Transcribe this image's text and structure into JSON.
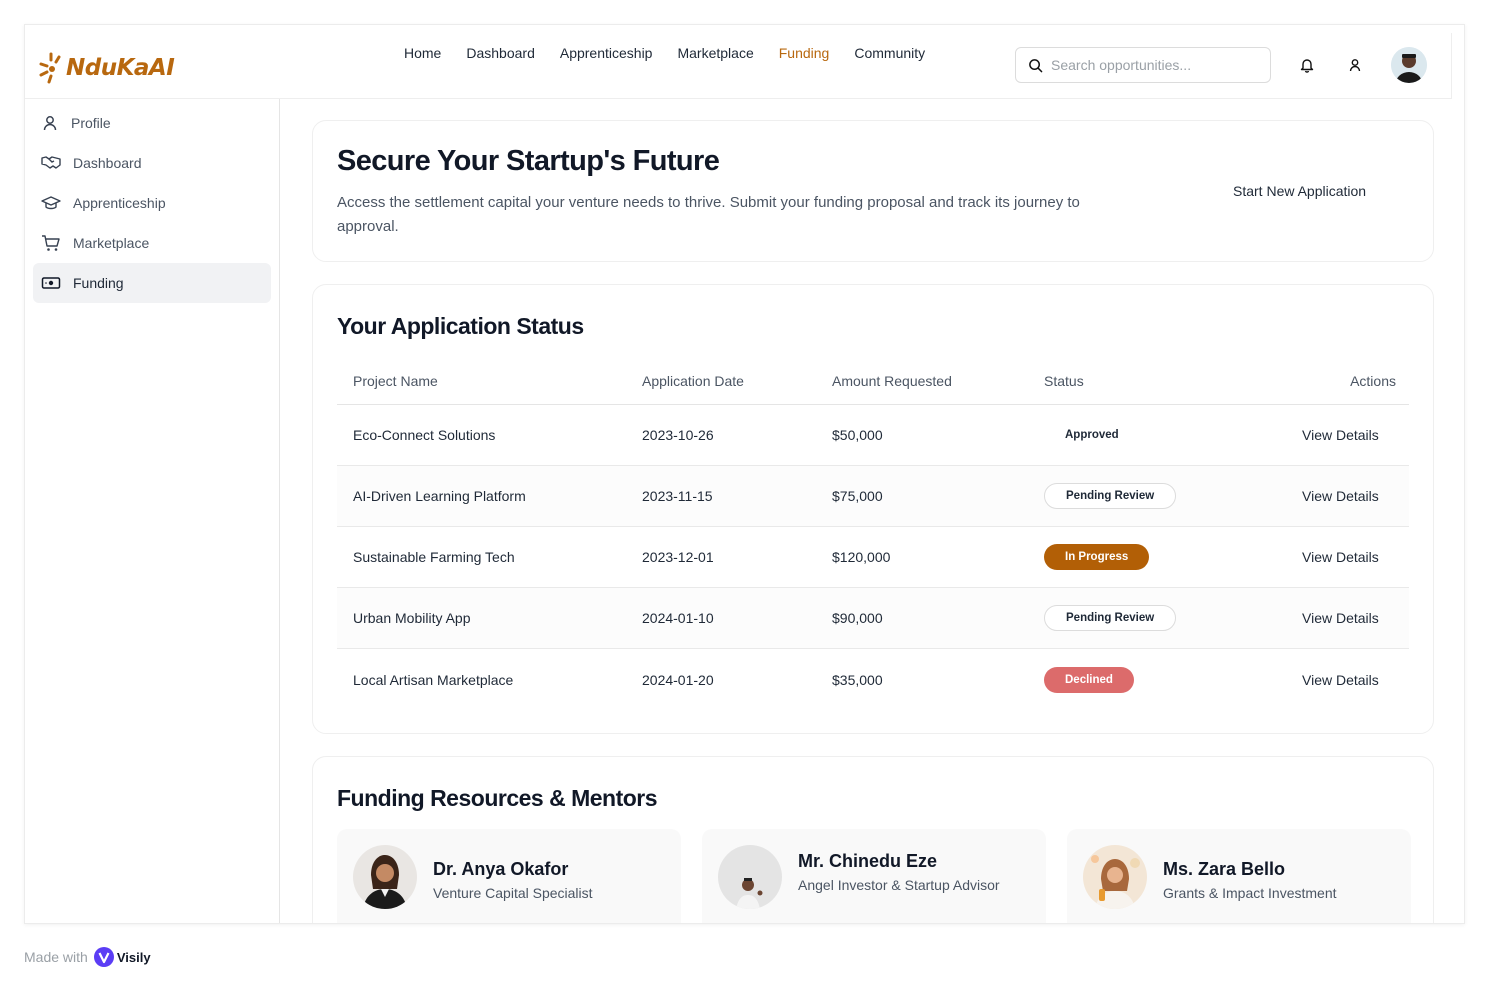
{
  "brand": {
    "name": "NduKaAI",
    "color": "#b8680f"
  },
  "nav": {
    "items": [
      "Home",
      "Dashboard",
      "Apprenticeship",
      "Marketplace",
      "Funding",
      "Community"
    ],
    "active": "Funding"
  },
  "search": {
    "placeholder": "Search opportunities..."
  },
  "sidebar": {
    "items": [
      {
        "label": "Profile",
        "icon": "user-icon"
      },
      {
        "label": "Dashboard",
        "icon": "handshake-icon"
      },
      {
        "label": "Apprenticeship",
        "icon": "graduation-cap-icon"
      },
      {
        "label": "Marketplace",
        "icon": "cart-icon"
      },
      {
        "label": "Funding",
        "icon": "banknote-icon"
      }
    ],
    "active": "Funding"
  },
  "hero": {
    "title": "Secure Your Startup's Future",
    "description": "Access the  settlement capital your venture needs to thrive. Submit your funding proposal and track its journey to approval.",
    "cta": "Start New Application"
  },
  "applications": {
    "title": "Your Application Status",
    "columns": [
      "Project Name",
      "Application Date",
      "Amount Requested",
      "Status",
      "Actions"
    ],
    "rows": [
      {
        "project": "Eco-Connect Solutions",
        "date": "2023-10-26",
        "amount": "$50,000",
        "status": "Approved",
        "action": "View Details"
      },
      {
        "project": "AI-Driven Learning Platform",
        "date": "2023-11-15",
        "amount": "$75,000",
        "status": "Pending Review",
        "action": "View Details"
      },
      {
        "project": "Sustainable Farming Tech",
        "date": "2023-12-01",
        "amount": "$120,000",
        "status": "In Progress",
        "action": "View Details"
      },
      {
        "project": "Urban Mobility App",
        "date": "2024-01-10",
        "amount": "$90,000",
        "status": "Pending Review",
        "action": "View Details"
      },
      {
        "project": "Local Artisan Marketplace",
        "date": "2024-01-20",
        "amount": "$35,000",
        "status": "Declined",
        "action": "View Details"
      }
    ],
    "status_colors": {
      "In Progress": "#b25f06",
      "Declined": "#dc6b6b"
    }
  },
  "resources": {
    "title": "Funding Resources & Mentors",
    "mentors": [
      {
        "name": "Dr. Anya Okafor",
        "role": "Venture Capital Specialist"
      },
      {
        "name": "Mr. Chinedu Eze",
        "role": "Angel Investor & Startup Advisor"
      },
      {
        "name": "Ms. Zara Bello",
        "role": "Grants & Impact Investment"
      }
    ]
  },
  "footer": {
    "made_with": "Made with",
    "brand": "Visily"
  }
}
